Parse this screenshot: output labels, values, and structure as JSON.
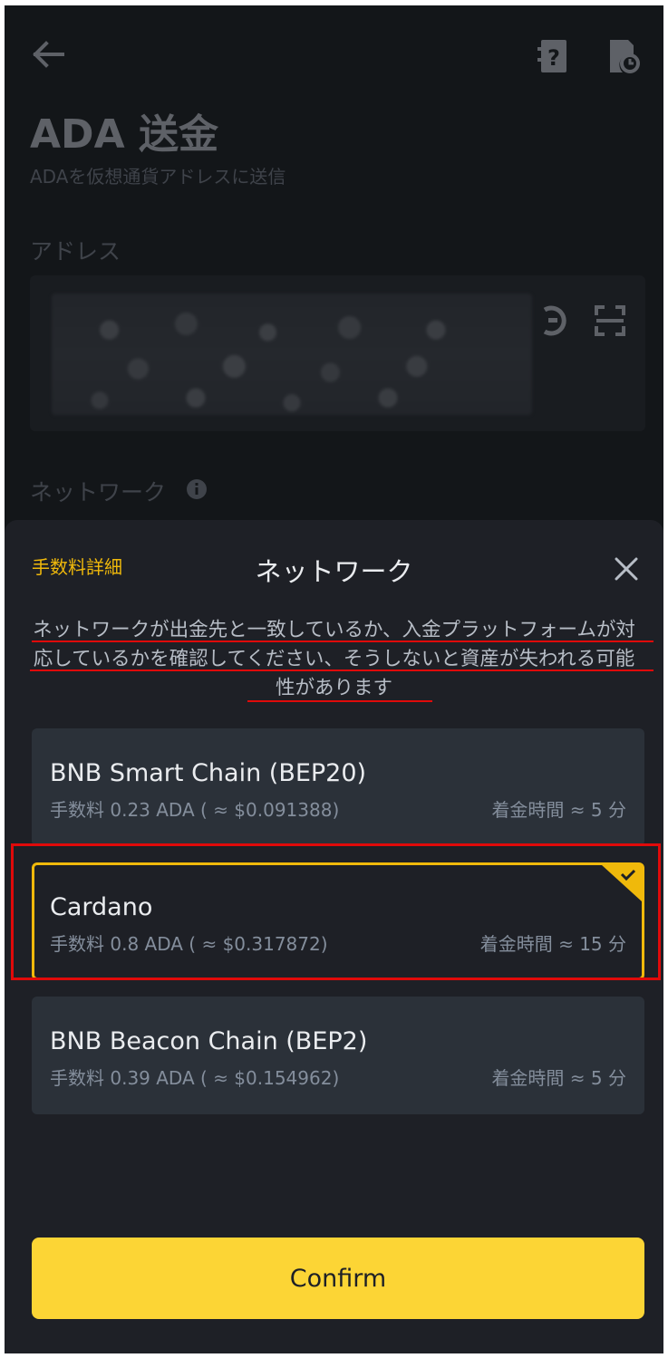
{
  "page": {
    "title": "ADA 送金",
    "subtitle": "ADAを仮想通貨アドレスに送信",
    "address_label": "アドレス",
    "network_label": "ネットワーク"
  },
  "sheet": {
    "fee_detail_label": "手数料詳細",
    "title": "ネットワーク",
    "warning": "ネットワークが出金先と一致しているか、入金プラットフォームが対応しているかを確認してください、そうしないと資産が失われる可能性があります",
    "options": [
      {
        "name": "BNB Smart Chain (BEP20)",
        "fee": "手数料 0.23 ADA ( ≈ $0.091388)",
        "time": "着金時間 ≈ 5 分",
        "selected": false
      },
      {
        "name": "Cardano",
        "fee": "手数料 0.8 ADA ( ≈ $0.317872)",
        "time": "着金時間 ≈ 15 分",
        "selected": true
      },
      {
        "name": "BNB Beacon Chain (BEP2)",
        "fee": "手数料 0.39 ADA ( ≈ $0.154962)",
        "time": "着金時間 ≈ 5 分",
        "selected": false
      }
    ],
    "confirm_label": "Confirm"
  },
  "colors": {
    "accent": "#f0b90b",
    "button": "#fcd535",
    "annotation_red": "#e00a0a",
    "sheet_bg": "#1e2026",
    "option_bg": "#2b3139"
  },
  "icons": [
    "back-arrow-icon",
    "help-icon",
    "history-icon",
    "contact-icon",
    "scan-icon",
    "info-icon",
    "close-icon",
    "checkmark-icon"
  ]
}
